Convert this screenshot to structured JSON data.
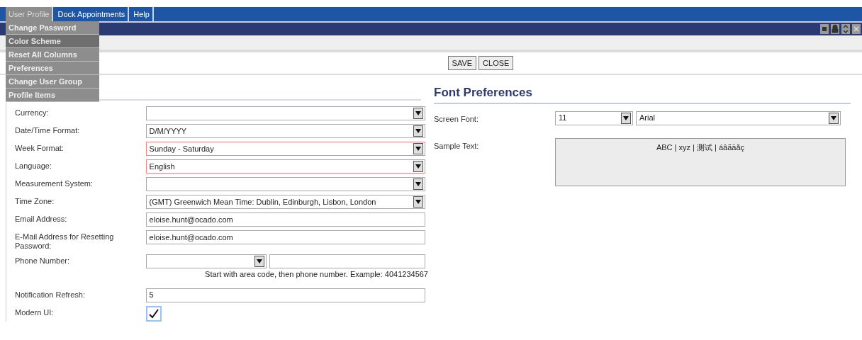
{
  "menu_bar": [
    {
      "label": "User Profile",
      "selected": true
    },
    {
      "label": "Dock Appointments",
      "selected": false
    },
    {
      "label": "Help",
      "selected": false
    }
  ],
  "user_profile_menu": [
    {
      "label": "Change Password",
      "selected": false
    },
    {
      "label": "Color Scheme",
      "selected": true
    },
    {
      "label": "Reset All Columns",
      "selected": false
    },
    {
      "label": "Preferences",
      "selected": false
    },
    {
      "label": "Change User Group",
      "selected": false
    },
    {
      "label": "Profile Items",
      "selected": false
    }
  ],
  "buttons": [
    "SAVE",
    "CLOSE"
  ],
  "form": [
    {
      "label": "Currency:",
      "kind": "select",
      "invalid": false
    },
    {
      "label": "Date/Time Format:",
      "kind": "select",
      "value": "D/M/YYYY",
      "invalid": false
    },
    {
      "label": "Week Format:",
      "kind": "select",
      "value": "Sunday - Saturday",
      "invalid": true
    },
    {
      "label": "Language:",
      "kind": "select",
      "value": "English",
      "invalid": true
    },
    {
      "label": "Measurement System:",
      "kind": "select",
      "invalid": false
    },
    {
      "label": "Time Zone:",
      "kind": "select",
      "value": "(GMT) Greenwich Mean Time: Dublin, Edinburgh, Lisbon, London",
      "invalid": false
    },
    {
      "label": "Email Address:",
      "kind": "input",
      "value": "eloise.hunt@ocado.com"
    },
    {
      "label": "E-Mail Address for Resetting Password:",
      "kind": "input",
      "value": "eloise.hunt@ocado.com"
    },
    {
      "label": "Phone Number:",
      "kind": "phone",
      "hint": "Start with area code, then phone number. Example: 4041234567"
    },
    {
      "label": "Notification Refresh:",
      "kind": "input",
      "value": "5"
    },
    {
      "label": "Modern UI:",
      "kind": "checkbox",
      "checked": true
    }
  ],
  "font_preferences": {
    "title": "Font Preferences",
    "screen_font_label": "Screen Font:",
    "size": "11",
    "family": "Arial",
    "sample_label": "Sample Text:",
    "sample": "ABC | xyz | 测试 | áâãäåç"
  }
}
